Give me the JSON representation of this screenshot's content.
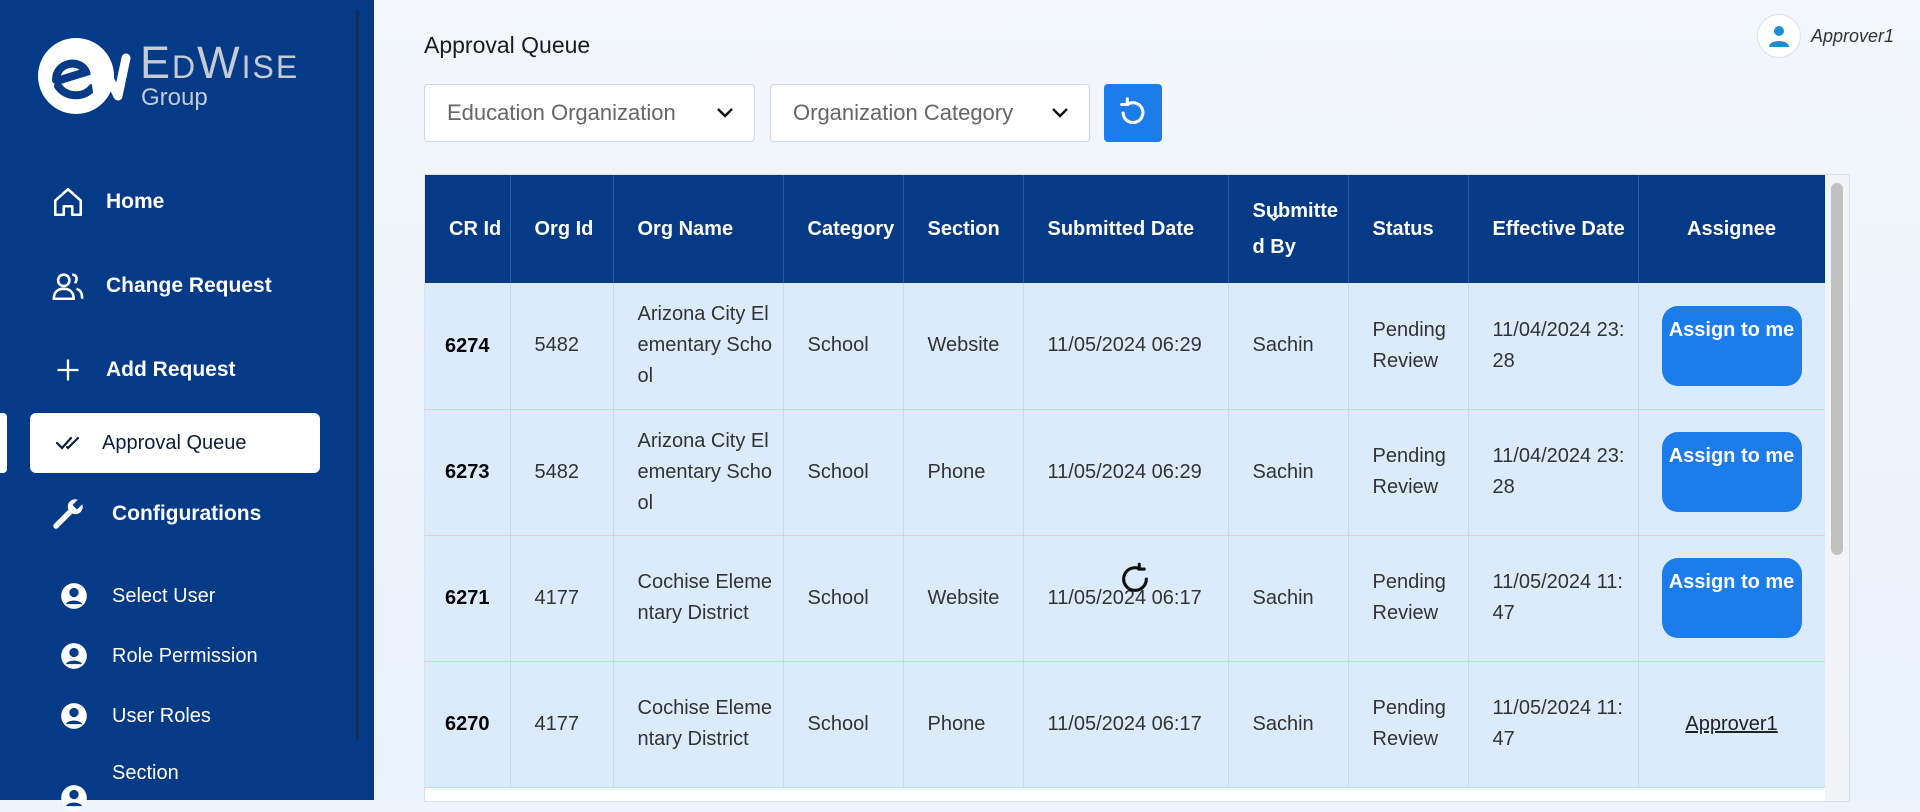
{
  "brand": {
    "name": "EdWise",
    "sub": "Group"
  },
  "sidebar": {
    "items": [
      {
        "label": "Home",
        "icon": "home-icon"
      },
      {
        "label": "Change Request",
        "icon": "users-icon"
      },
      {
        "label": "Add Request",
        "icon": "plus-icon"
      },
      {
        "label": "Approval Queue",
        "icon": "double-check-icon",
        "active": true
      },
      {
        "label": "Configurations",
        "icon": "wrench-icon"
      }
    ],
    "sub_items": [
      {
        "label": "Select User",
        "icon": "user-circle-icon"
      },
      {
        "label": "Role Permission",
        "icon": "user-circle-icon"
      },
      {
        "label": "User Roles",
        "icon": "user-circle-icon"
      },
      {
        "label": "Section",
        "icon": "user-circle-icon"
      }
    ]
  },
  "header": {
    "title": "Approval Queue",
    "user": "Approver1"
  },
  "filters": {
    "education_org": "Education Organization",
    "org_category": "Organization Category"
  },
  "table": {
    "columns": [
      "CR Id",
      "Org Id",
      "Org Name",
      "Category",
      "Section",
      "Submitted Date",
      "Submitted By",
      "Status",
      "Effective Date",
      "Assignee"
    ],
    "rows": [
      {
        "cr_id": "6274",
        "org_id": "5482",
        "org_name": "Arizona City Elementary School",
        "category": "School",
        "section": "Website",
        "submitted_date": "11/05/2024 06:29",
        "submitted_by": "Sachin",
        "status": "Pending Review",
        "effective_date": "11/04/2024 23:28",
        "assignee": "Assign to me",
        "assigned": false
      },
      {
        "cr_id": "6273",
        "org_id": "5482",
        "org_name": "Arizona City Elementary School",
        "category": "School",
        "section": "Phone",
        "submitted_date": "11/05/2024 06:29",
        "submitted_by": "Sachin",
        "status": "Pending Review",
        "effective_date": "11/04/2024 23:28",
        "assignee": "Assign to me",
        "assigned": false
      },
      {
        "cr_id": "6271",
        "org_id": "4177",
        "org_name": "Cochise Elementary District",
        "category": "School",
        "section": "Website",
        "submitted_date": "11/05/2024 06:17",
        "submitted_by": "Sachin",
        "status": "Pending Review",
        "effective_date": "11/05/2024 11:47",
        "assignee": "Assign to me",
        "assigned": false
      },
      {
        "cr_id": "6270",
        "org_id": "4177",
        "org_name": "Cochise Elementary District",
        "category": "School",
        "section": "Phone",
        "submitted_date": "11/05/2024 06:17",
        "submitted_by": "Sachin",
        "status": "Pending Review",
        "effective_date": "11/05/2024 11:47",
        "assignee": "Approver1",
        "assigned": true
      }
    ]
  },
  "colors": {
    "sidebar_bg": "#053a86",
    "accent": "#1b7cea",
    "row_bg": "#dbebfb"
  }
}
